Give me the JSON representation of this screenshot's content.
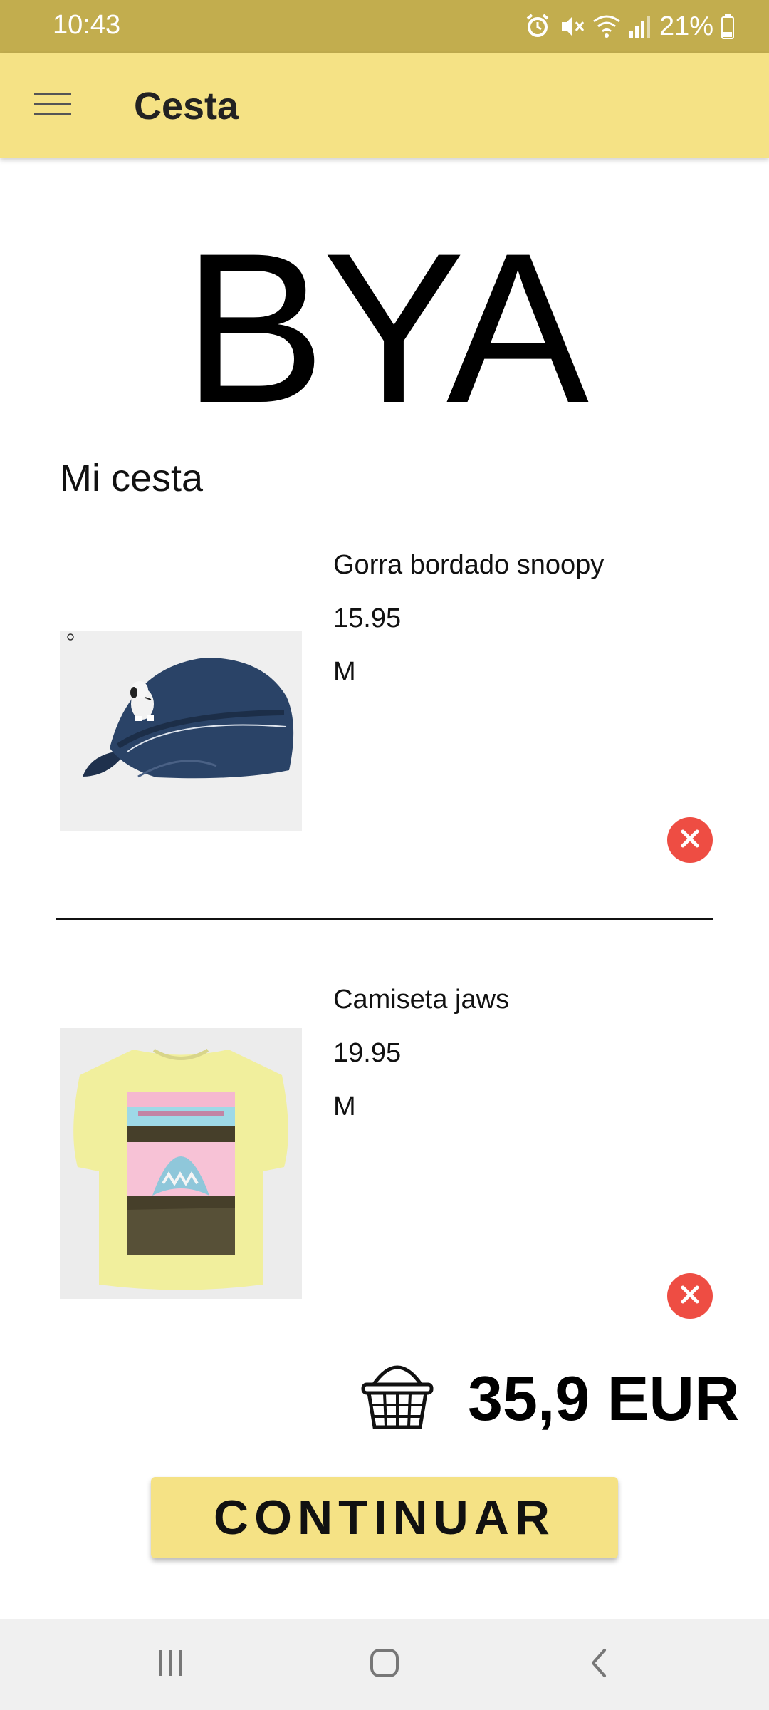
{
  "status_bar": {
    "time": "10:43",
    "battery": "21%",
    "icons": [
      "alarm-icon",
      "mute-icon",
      "wifi-icon",
      "signal-icon",
      "battery-icon"
    ]
  },
  "app_bar": {
    "title": "Cesta",
    "menu_icon": "hamburger-menu-icon"
  },
  "brand": {
    "logo_text": "BYA"
  },
  "cart": {
    "section_title": "Mi cesta",
    "items": [
      {
        "name": "Gorra bordado snoopy",
        "price": "15.95",
        "size": "M",
        "image": "navy-cap-image"
      },
      {
        "name": "Camiseta jaws",
        "price": "19.95",
        "size": "M",
        "image": "yellow-jaws-tshirt-image"
      }
    ],
    "remove_icon": "remove-icon"
  },
  "total": {
    "amount": "35,9 EUR",
    "icon": "basket-icon"
  },
  "actions": {
    "continue_label": "CONTINUAR"
  },
  "navigation_bar": {
    "items": [
      "recents-icon",
      "home-icon",
      "back-icon"
    ]
  },
  "colors": {
    "status_bar": "#c2ad4e",
    "app_bar": "#f5e285",
    "remove_button": "#ee4d43",
    "continue_button": "#f5e285"
  }
}
